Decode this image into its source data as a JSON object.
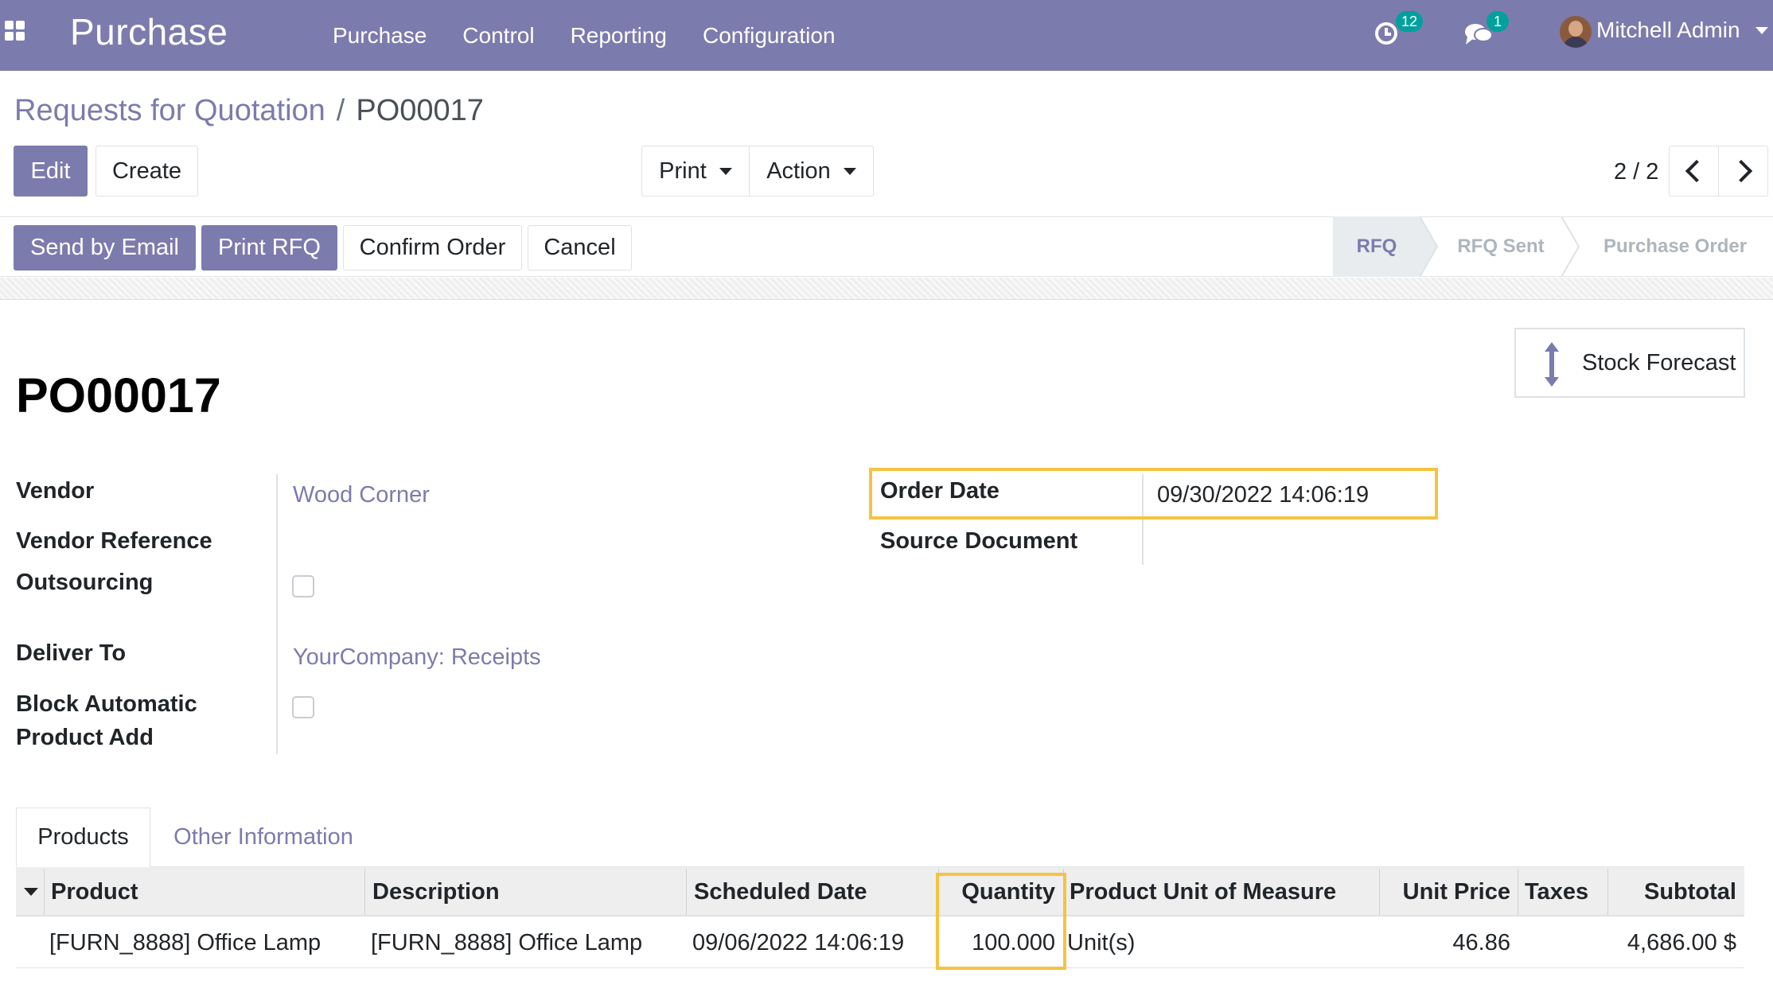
{
  "navbar": {
    "app_name": "Purchase",
    "menu": [
      "Purchase",
      "Control",
      "Reporting",
      "Configuration"
    ],
    "activity_count": "12",
    "message_count": "1",
    "user_name": "Mitchell Admin",
    "icons": [
      "apps-grid-icon",
      "activity-clock-icon",
      "chat-bubbles-icon",
      "user-avatar",
      "caret-down-icon"
    ]
  },
  "breadcrumb": {
    "parent": "Requests for Quotation",
    "separator": "/",
    "current": "PO00017"
  },
  "control_panel": {
    "edit_label": "Edit",
    "create_label": "Create",
    "print_label": "Print",
    "action_label": "Action",
    "pager": "2 / 2"
  },
  "statusbar": {
    "buttons": [
      "Send by Email",
      "Print RFQ",
      "Confirm Order",
      "Cancel"
    ],
    "stages": [
      "RFQ",
      "RFQ Sent",
      "Purchase Order"
    ],
    "active_stage": "RFQ"
  },
  "sheet": {
    "name": "PO00017",
    "stock_forecast_label": "Stock Forecast",
    "left_fields": {
      "vendor_label": "Vendor",
      "vendor_value": "Wood Corner",
      "vendor_ref_label": "Vendor Reference",
      "vendor_ref_value": "",
      "outsourcing_label": "Outsourcing",
      "outsourcing_checked": false,
      "deliver_to_label": "Deliver To",
      "deliver_to_value": "YourCompany: Receipts",
      "block_label_line1": "Block Automatic",
      "block_label_line2": "Product Add",
      "block_checked": false
    },
    "right_fields": {
      "order_date_label": "Order Date",
      "order_date_value": "09/30/2022 14:06:19",
      "source_doc_label": "Source Document",
      "source_doc_value": ""
    }
  },
  "tabs": {
    "products": "Products",
    "other": "Other Information"
  },
  "order_lines": {
    "columns": [
      "Product",
      "Description",
      "Scheduled Date",
      "Quantity",
      "Product Unit of Measure",
      "Unit Price",
      "Taxes",
      "Subtotal"
    ],
    "rows": [
      {
        "product": "[FURN_8888] Office Lamp",
        "description": "[FURN_8888] Office Lamp",
        "scheduled_date": "09/06/2022 14:06:19",
        "quantity": "100.000",
        "uom": "Unit(s)",
        "unit_price": "46.86",
        "taxes": "",
        "subtotal": "4,686.00 $"
      }
    ]
  },
  "colors": {
    "brand": "#7c7bad",
    "highlight": "#f5c342",
    "badge": "#00a09d"
  }
}
